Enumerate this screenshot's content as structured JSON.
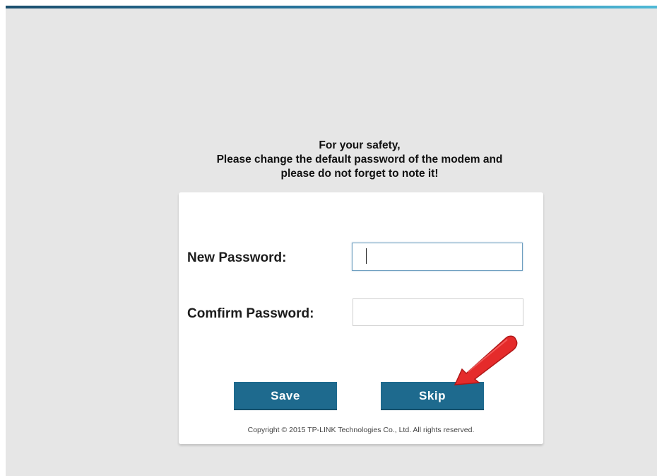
{
  "notice": {
    "line1": "For your safety,",
    "line2": "Please change the default password of the modem and",
    "line3": "please do not forget to note it!"
  },
  "form": {
    "new_password_label": "New Password:",
    "new_password_value": "",
    "confirm_password_label": "Comfirm Password:",
    "confirm_password_value": ""
  },
  "buttons": {
    "save_label": "Save",
    "skip_label": "Skip"
  },
  "footer": {
    "copyright": "Copyright © 2015 TP-LINK Technologies Co., Ltd. All rights reserved."
  },
  "colors": {
    "button": "#1e6a8e",
    "arrow": "#e52b2b"
  },
  "annotation": {
    "arrow_icon": "red-pointer-arrow"
  }
}
